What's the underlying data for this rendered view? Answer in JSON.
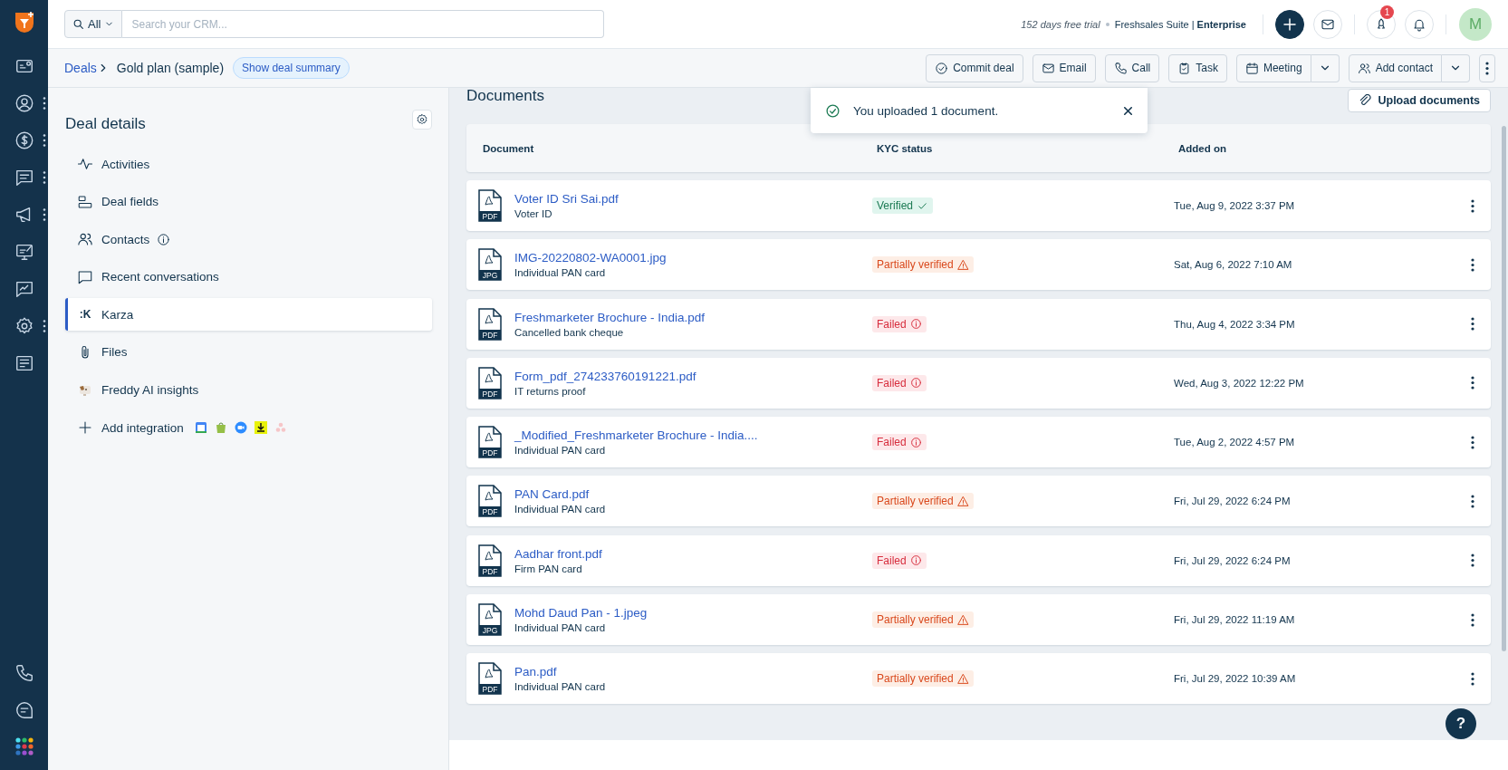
{
  "top_bar": {
    "search": {
      "scope": "All",
      "placeholder": "Search your CRM..."
    },
    "trial": "152 days free trial",
    "plan": "Freshsales Suite | **Enterprise**",
    "notification_badge": "1",
    "avatar": "M"
  },
  "breadcrumb": {
    "parent": "Deals",
    "current": "Gold plan (sample)",
    "summary_button": "Show deal summary"
  },
  "actions": [
    {
      "label": "Commit deal",
      "kind": "plain"
    },
    {
      "label": "Email",
      "kind": "plain"
    },
    {
      "label": "Call",
      "kind": "plain"
    },
    {
      "label": "Task",
      "kind": "plain"
    },
    {
      "label": "Meeting",
      "kind": "split"
    },
    {
      "label": "Add contact",
      "kind": "split"
    }
  ],
  "deal_details": {
    "title": "Deal details",
    "items": [
      {
        "label": "Activities",
        "kind": "plain",
        "selected": false
      },
      {
        "label": "Deal fields",
        "kind": "plain",
        "selected": false
      },
      {
        "label": "Contacts",
        "kind": "info",
        "selected": false
      },
      {
        "label": "Recent conversations",
        "kind": "plain",
        "selected": false
      },
      {
        "label": "Karza",
        "kind": "plain",
        "icon_text": ":K",
        "selected": true
      },
      {
        "label": "Files",
        "kind": "plain",
        "selected": false
      },
      {
        "label": "Freddy AI insights",
        "kind": "plain",
        "selected": false
      },
      {
        "label": "Add integration",
        "kind": "add",
        "selected": false
      }
    ]
  },
  "documents": {
    "title": "Documents",
    "upload_button": "Upload documents",
    "columns": [
      "Document",
      "KYC status",
      "Added on"
    ],
    "rows": [
      {
        "name": "Voter ID Sri Sai.pdf",
        "type": "PDF",
        "doc_type": "Voter ID",
        "status": {
          "label": "Verified",
          "kind": "verified"
        },
        "added_on": "Tue, Aug 9, 2022 3:37 PM"
      },
      {
        "name": "IMG-20220802-WA0001.jpg",
        "type": "JPG",
        "doc_type": "Individual PAN card",
        "status": {
          "label": "Partially verified",
          "kind": "partial"
        },
        "added_on": "Sat, Aug 6, 2022 7:10 AM"
      },
      {
        "name": "Freshmarketer Brochure - India.pdf",
        "type": "PDF",
        "doc_type": "Cancelled bank cheque",
        "status": {
          "label": "Failed",
          "kind": "failed"
        },
        "added_on": "Thu, Aug 4, 2022 3:34 PM"
      },
      {
        "name": "Form_pdf_274233760191221.pdf",
        "type": "PDF",
        "doc_type": "IT returns proof",
        "status": {
          "label": "Failed",
          "kind": "failed"
        },
        "added_on": "Wed, Aug 3, 2022 12:22 PM"
      },
      {
        "name": "_Modified_Freshmarketer Brochure - India....",
        "type": "PDF",
        "doc_type": "Individual PAN card",
        "status": {
          "label": "Failed",
          "kind": "failed"
        },
        "added_on": "Tue, Aug 2, 2022 4:57 PM"
      },
      {
        "name": "PAN Card.pdf",
        "type": "PDF",
        "doc_type": "Individual PAN card",
        "status": {
          "label": "Partially verified",
          "kind": "partial"
        },
        "added_on": "Fri, Jul 29, 2022 6:24 PM"
      },
      {
        "name": "Aadhar front.pdf",
        "type": "PDF",
        "doc_type": "Firm PAN card",
        "status": {
          "label": "Failed",
          "kind": "failed"
        },
        "added_on": "Fri, Jul 29, 2022 6:24 PM"
      },
      {
        "name": "Mohd Daud Pan - 1.jpeg",
        "type": "JPG",
        "doc_type": "Individual PAN card",
        "status": {
          "label": "Partially verified",
          "kind": "partial"
        },
        "added_on": "Fri, Jul 29, 2022 11:19 AM"
      },
      {
        "name": "Pan.pdf",
        "type": "PDF",
        "doc_type": "Individual PAN card",
        "status": {
          "label": "Partially verified",
          "kind": "partial"
        },
        "added_on": "Fri, Jul 29, 2022 10:39 AM"
      }
    ]
  },
  "toast": {
    "message": "You uploaded 1 document."
  },
  "help_button": "?"
}
